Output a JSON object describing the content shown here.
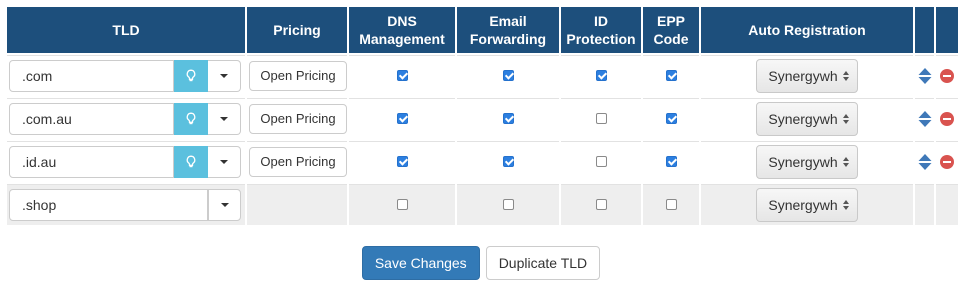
{
  "columns": {
    "tld": "TLD",
    "pricing": "Pricing",
    "dns_line1": "DNS",
    "dns_line2": "Management",
    "email_line1": "Email",
    "email_line2": "Forwarding",
    "idp_line1": "ID",
    "idp_line2": "Protection",
    "epp_line1": "EPP",
    "epp_line2": "Code",
    "auto_registration": "Auto Registration"
  },
  "rows": [
    {
      "tld": ".com",
      "pricing_label": "Open Pricing",
      "dns": true,
      "email": true,
      "idp": true,
      "epp": true,
      "registrar": "Synergywh"
    },
    {
      "tld": ".com.au",
      "pricing_label": "Open Pricing",
      "dns": true,
      "email": true,
      "idp": false,
      "epp": true,
      "registrar": "Synergywh"
    },
    {
      "tld": ".id.au",
      "pricing_label": "Open Pricing",
      "dns": true,
      "email": true,
      "idp": false,
      "epp": true,
      "registrar": "Synergywh"
    }
  ],
  "new_row": {
    "tld": ".shop",
    "dns": false,
    "email": false,
    "idp": false,
    "epp": false,
    "registrar": "Synergywh"
  },
  "icons": {
    "pricing": "lightbulb-icon",
    "dropdown": "caret-down-icon",
    "sort": "sort-icon",
    "remove": "minus-circle-icon"
  },
  "colors": {
    "header_bg": "#1d4f7c",
    "info": "#5bc0de",
    "primary": "#337ab7",
    "danger": "#d9534f",
    "sort": "#3f78b8"
  },
  "actions": {
    "save_label": "Save Changes",
    "duplicate_label": "Duplicate TLD"
  }
}
